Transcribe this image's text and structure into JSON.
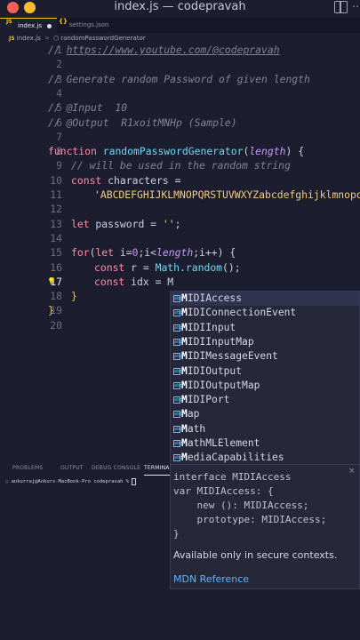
{
  "window": {
    "title": "index.js — codepravah"
  },
  "tabs": [
    {
      "label": "index.js",
      "glyph": "JS",
      "modified": true,
      "active": true
    },
    {
      "label": "settings.json",
      "glyph": "{}",
      "active": false
    }
  ],
  "breadcrumb": {
    "file": "index.js",
    "separator": ">",
    "symbol": "randomPasswordGenerator"
  },
  "editor": {
    "current_line": 17,
    "line_numbers": [
      "1",
      "2",
      "3",
      "4",
      "5",
      "6",
      "7",
      "8",
      "9",
      "10",
      "11",
      "12",
      "13",
      "14",
      "15",
      "16",
      "17",
      "18",
      "19",
      "20"
    ],
    "lines": {
      "l1_prefix": "// ",
      "l1_link": "https://www.youtube.com/@codepravah",
      "l3": "// Generate random Password of given length",
      "l5": "// @Input  10",
      "l6": "// @Output  R1xoitMNHp (Sample)",
      "l8_kw": "function",
      "l8_fn": "randomPasswordGenerator",
      "l8_open": "(",
      "l8_param": "length",
      "l8_close": ") {",
      "l9": "// will be used in the random string",
      "l10_kw": "const",
      "l10_rest": " characters =",
      "l11": "'ABCDEFGHIJKLMNOPQRSTUVWXYZabcdefghijklmnopqrs",
      "l13_kw": "let",
      "l13_rest": " password = ",
      "l13_str": "''",
      "l13_end": ";",
      "l15_kw": "for",
      "l15_a": "(",
      "l15_let": "let",
      "l15_b": " i=",
      "l15_zero": "0",
      "l15_c": ";i<",
      "l15_len": "length",
      "l15_d": ";i++) {",
      "l16_kw": "const",
      "l16_a": " r = ",
      "l16_math": "Math",
      "l16_b": ".",
      "l16_fn": "random",
      "l16_c": "();",
      "l17_kw": "const",
      "l17_rest": " idx = M",
      "l18": "}",
      "l19": "}"
    }
  },
  "suggestions": {
    "icon_label": "abc",
    "typed": "M",
    "items": [
      {
        "match": "M",
        "rest": "IDIAccess"
      },
      {
        "match": "M",
        "rest": "IDIConnectionEvent"
      },
      {
        "match": "M",
        "rest": "IDIInput"
      },
      {
        "match": "M",
        "rest": "IDIInputMap"
      },
      {
        "match": "M",
        "rest": "IDIMessageEvent"
      },
      {
        "match": "M",
        "rest": "IDIOutput"
      },
      {
        "match": "M",
        "rest": "IDIOutputMap"
      },
      {
        "match": "M",
        "rest": "IDIPort"
      },
      {
        "match": "M",
        "rest": "ap"
      },
      {
        "match": "M",
        "rest": "ath"
      },
      {
        "match": "M",
        "rest": "athMLElement"
      },
      {
        "match": "M",
        "rest": "ediaCapabilities"
      }
    ],
    "selected_index": 0
  },
  "details": {
    "code": "interface MIDIAccess\nvar MIDIAccess: {\n    new (): MIDIAccess;\n    prototype: MIDIAccess;\n}",
    "note": "Available only in secure contexts.",
    "link": "MDN Reference",
    "close": "×"
  },
  "panel": {
    "tabs": [
      "PROBLEMS",
      "OUTPUT",
      "DEBUG CONSOLE",
      "TERMINAL"
    ],
    "active_tab": "TERMINAL",
    "terminal_prompt": "ankurraj@Ankurs-MacBook-Pro codepravah % "
  }
}
